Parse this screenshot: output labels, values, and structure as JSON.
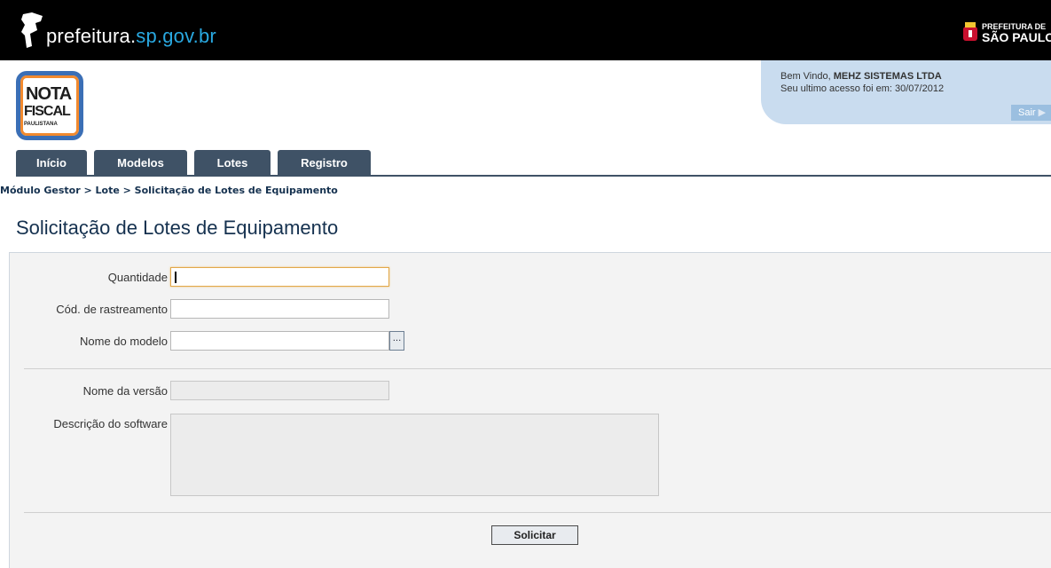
{
  "header": {
    "site_prefix": "prefeitura.",
    "site_highlight": "sp.gov.br",
    "city_logo_line1": "PREFEITURA DE",
    "city_logo_line2": "SÃO PAULO"
  },
  "logo": {
    "line1": "NOTA",
    "line2": "FISCAL",
    "line3": "PAULISTANA"
  },
  "welcome": {
    "greeting": "Bem Vindo, ",
    "user": "MEHZ SISTEMAS LTDA",
    "last_access": "Seu ultimo acesso foi em: 30/07/2012",
    "logout": "Sair"
  },
  "tabs": [
    {
      "label": "Início"
    },
    {
      "label": "Modelos"
    },
    {
      "label": "Lotes"
    },
    {
      "label": "Registro"
    }
  ],
  "breadcrumb": "Módulo Gestor > Lote > Solicitação de Lotes de Equipamento",
  "page_title": "Solicitação de Lotes de Equipamento",
  "form": {
    "quantidade_label": "Quantidade",
    "quantidade_value": "",
    "cod_label": "Cód. de rastreamento",
    "cod_value": "",
    "modelo_label": "Nome do modelo",
    "modelo_value": "",
    "lookup_label": "...",
    "versao_label": "Nome da versão",
    "versao_value": "",
    "descricao_label": "Descrição do software",
    "descricao_value": "",
    "submit_label": "Solicitar"
  },
  "colors": {
    "topbar": "#000000",
    "tab_bg": "#3f5266",
    "title": "#15314f",
    "welcome_bg": "#c9dcef",
    "panel_bg": "#f3f3f3",
    "focus_border": "#e2a84a"
  }
}
